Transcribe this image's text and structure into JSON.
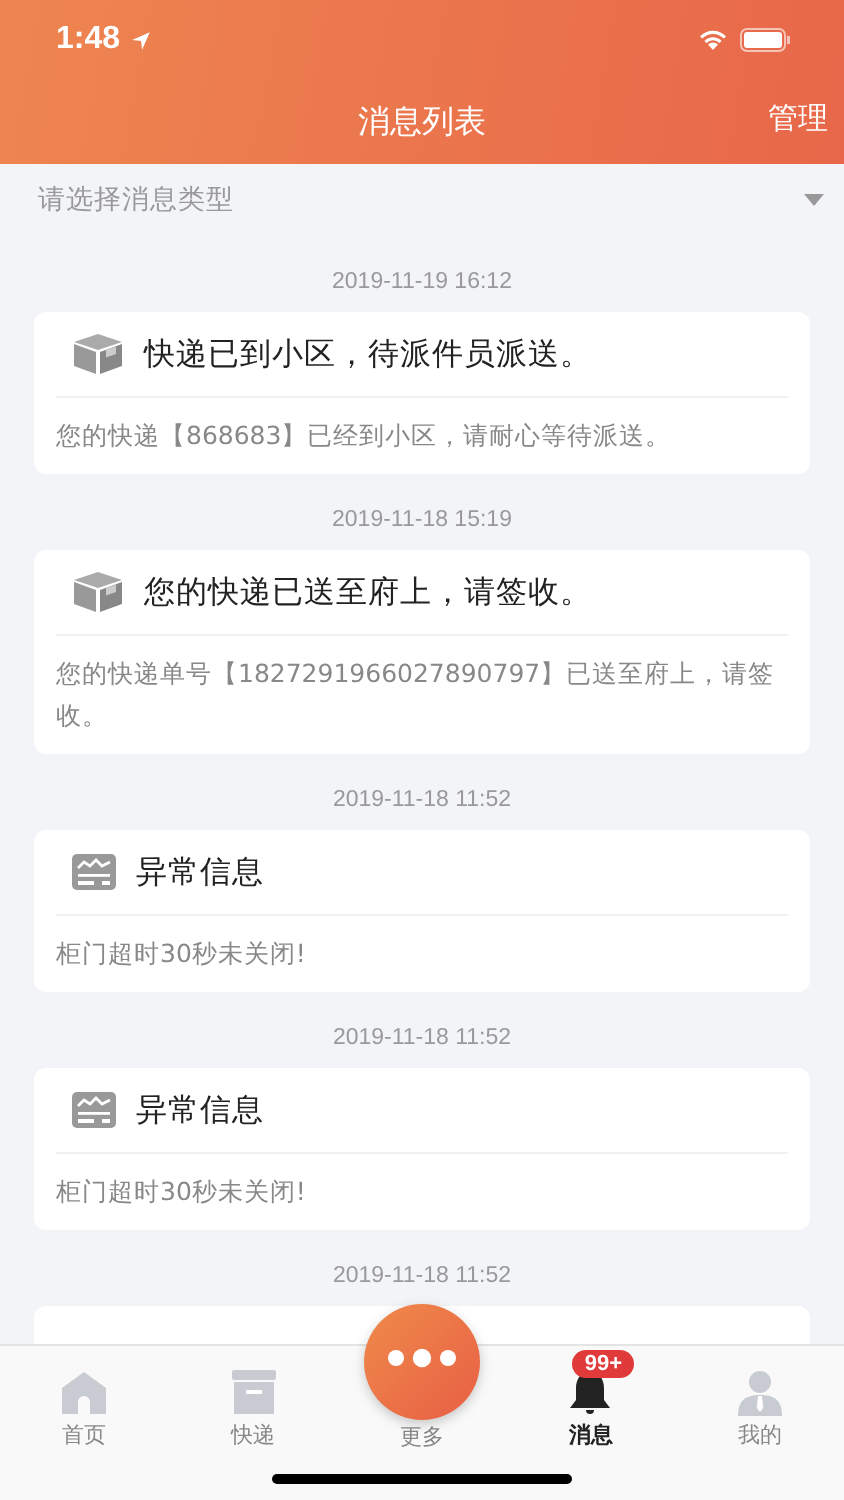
{
  "status_bar": {
    "time": "1:48"
  },
  "header": {
    "title": "消息列表",
    "action": "管理"
  },
  "filter": {
    "placeholder": "请选择消息类型"
  },
  "messages": [
    {
      "time": "2019-11-19 16:12",
      "kind": "parcel",
      "title": "快递已到小区，待派件员派送。",
      "body": "您的快递【868683】已经到小区，请耐心等待派送。"
    },
    {
      "time": "2019-11-18 15:19",
      "kind": "parcel",
      "title": "您的快递已送至府上，请签收。",
      "body": "您的快递单号【1827291966027890797】已送至府上，请签收。"
    },
    {
      "time": "2019-11-18 11:52",
      "kind": "alert",
      "title": "异常信息",
      "body": "柜门超时30秒未关闭!"
    },
    {
      "time": "2019-11-18 11:52",
      "kind": "alert",
      "title": "异常信息",
      "body": "柜门超时30秒未关闭!"
    },
    {
      "time": "2019-11-18 11:52",
      "kind": "hidden"
    }
  ],
  "tab_bar": [
    {
      "label": "首页",
      "kind": "home",
      "selected": false
    },
    {
      "label": "快递",
      "kind": "box",
      "selected": false
    },
    {
      "label": "更多",
      "kind": "more",
      "selected": false
    },
    {
      "label": "消息",
      "kind": "bell",
      "selected": true,
      "badge": "99+"
    },
    {
      "label": "我的",
      "kind": "person",
      "selected": false
    }
  ]
}
